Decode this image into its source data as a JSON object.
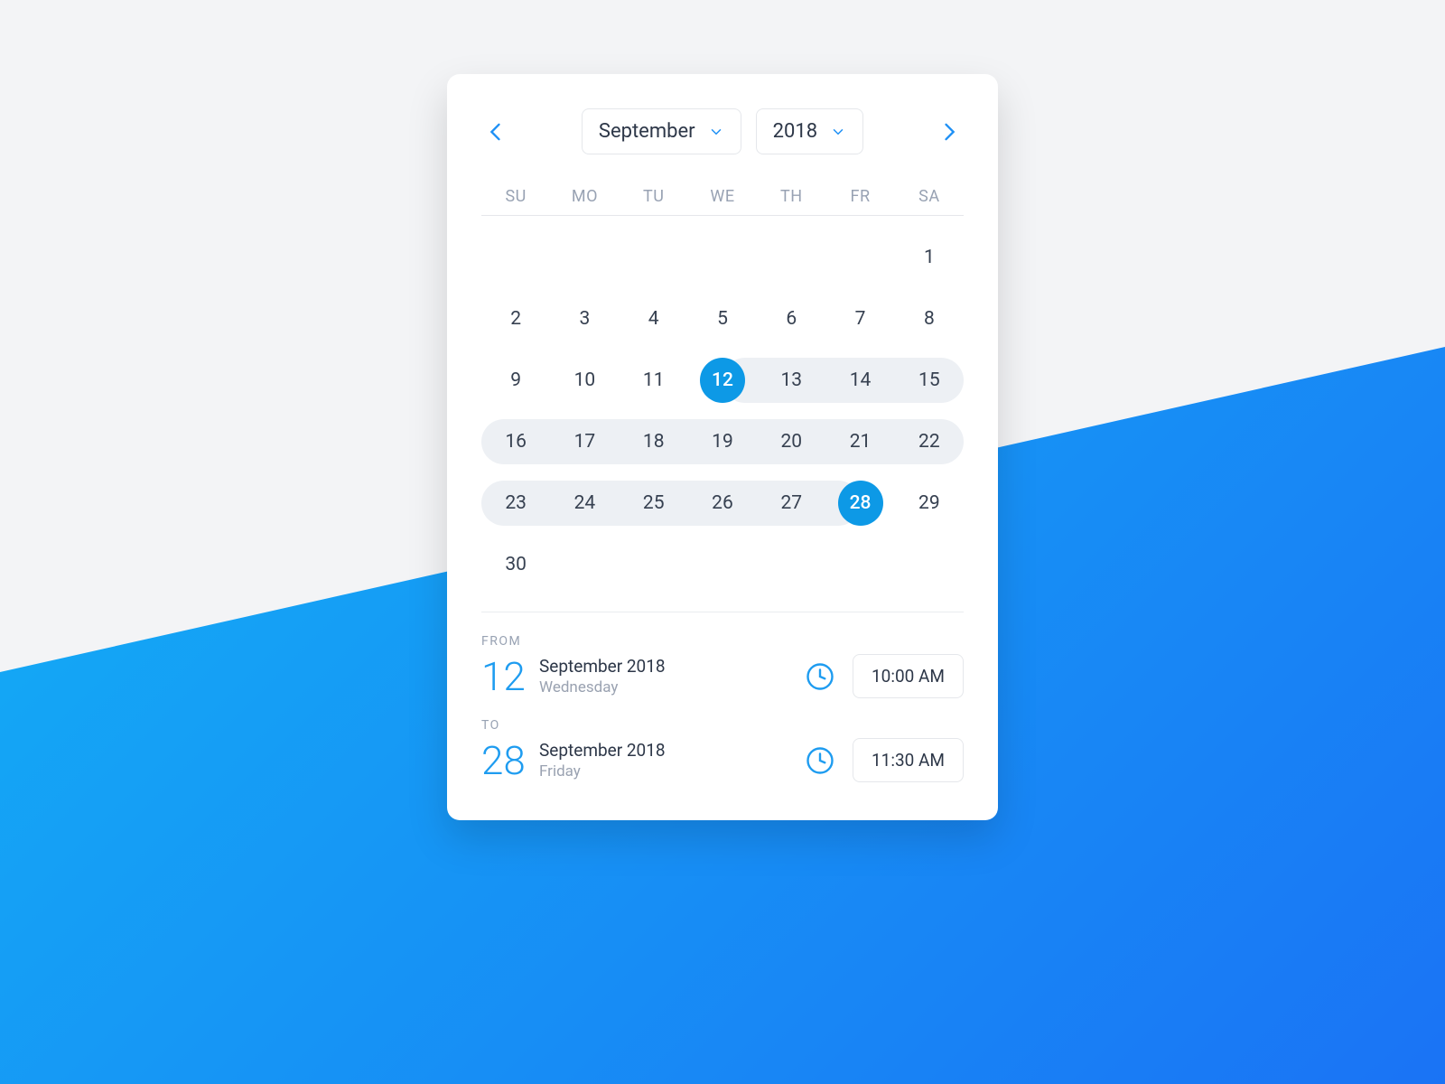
{
  "header": {
    "month": "September",
    "year": "2018"
  },
  "weekdays": [
    "SU",
    "MO",
    "TU",
    "WE",
    "TH",
    "FR",
    "SA"
  ],
  "weeks": [
    [
      {
        "n": ""
      },
      {
        "n": ""
      },
      {
        "n": ""
      },
      {
        "n": ""
      },
      {
        "n": ""
      },
      {
        "n": ""
      },
      {
        "n": "1"
      }
    ],
    [
      {
        "n": "2"
      },
      {
        "n": "3"
      },
      {
        "n": "4"
      },
      {
        "n": "5"
      },
      {
        "n": "6"
      },
      {
        "n": "7"
      },
      {
        "n": "8"
      }
    ],
    [
      {
        "n": "9"
      },
      {
        "n": "10"
      },
      {
        "n": "11"
      },
      {
        "n": "12",
        "sel": true,
        "rangeStart": true
      },
      {
        "n": "13",
        "in": true
      },
      {
        "n": "14",
        "in": true
      },
      {
        "n": "15",
        "in": true
      }
    ],
    [
      {
        "n": "16",
        "in": true
      },
      {
        "n": "17",
        "in": true
      },
      {
        "n": "18",
        "in": true
      },
      {
        "n": "19",
        "in": true
      },
      {
        "n": "20",
        "in": true
      },
      {
        "n": "21",
        "in": true
      },
      {
        "n": "22",
        "in": true
      }
    ],
    [
      {
        "n": "23",
        "in": true
      },
      {
        "n": "24",
        "in": true
      },
      {
        "n": "25",
        "in": true
      },
      {
        "n": "26",
        "in": true
      },
      {
        "n": "27",
        "in": true
      },
      {
        "n": "28",
        "sel": true,
        "rangeEnd": true
      },
      {
        "n": "29"
      }
    ],
    [
      {
        "n": "30"
      },
      {
        "n": ""
      },
      {
        "n": ""
      },
      {
        "n": ""
      },
      {
        "n": ""
      },
      {
        "n": ""
      },
      {
        "n": ""
      }
    ]
  ],
  "from": {
    "label": "FROM",
    "day": "12",
    "month_year": "September 2018",
    "dow": "Wednesday",
    "time": "10:00 AM"
  },
  "to": {
    "label": "TO",
    "day": "28",
    "month_year": "September 2018",
    "dow": "Friday",
    "time": "11:30 AM"
  }
}
